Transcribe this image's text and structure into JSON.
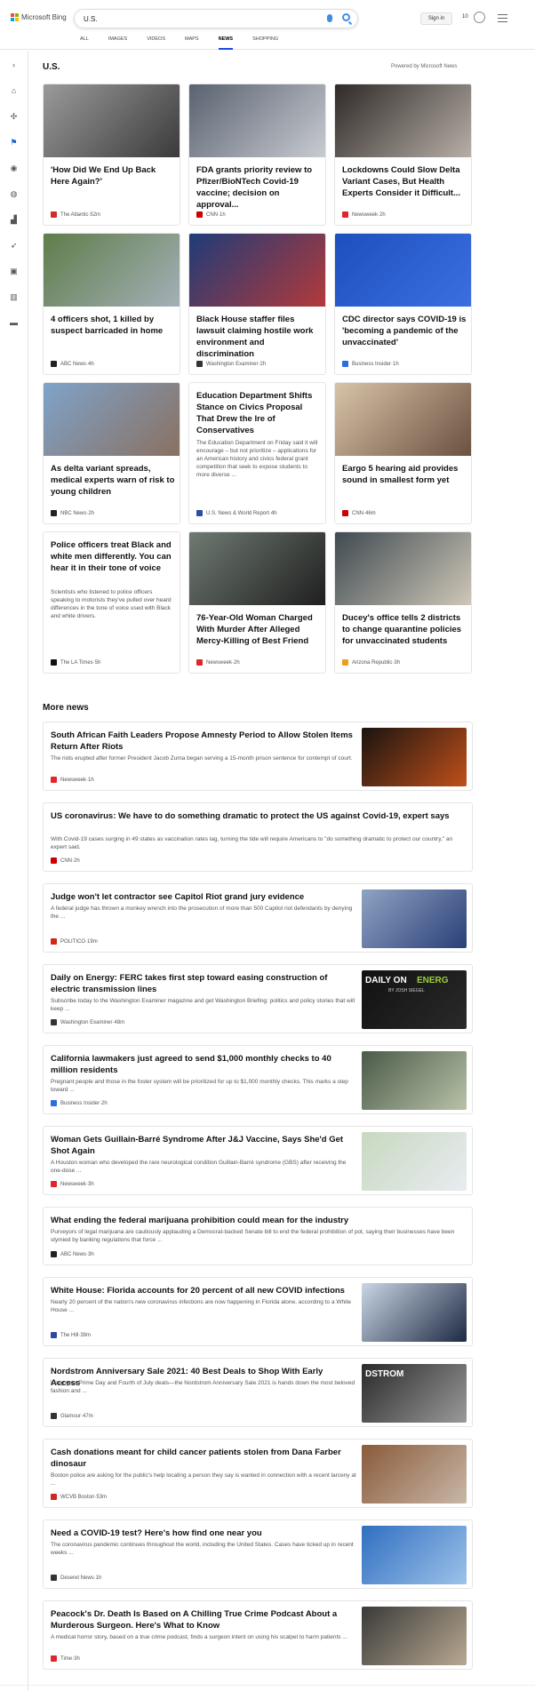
{
  "header": {
    "logo_text": "Microsoft Bing",
    "search_query": "U.S.",
    "sign_in": "Sign in",
    "rewards_count": "10"
  },
  "tabs": [
    {
      "label": "ALL",
      "active": false
    },
    {
      "label": "IMAGES",
      "active": false
    },
    {
      "label": "VIDEOS",
      "active": false
    },
    {
      "label": "MAPS",
      "active": false
    },
    {
      "label": "NEWS",
      "active": true
    },
    {
      "label": "SHOPPING",
      "active": false
    }
  ],
  "sidebar": {
    "icons": [
      "expand-icon",
      "home-icon",
      "puzzle-icon",
      "flag-icon",
      "location-icon",
      "globe-icon",
      "chart-icon",
      "rocket-icon",
      "film-icon",
      "bank-icon",
      "card-icon"
    ]
  },
  "section": {
    "title": "U.S.",
    "powered_by": "Powered by Microsoft News"
  },
  "cards": [
    {
      "title": "'How Did We End Up Back Here Again?'",
      "source": "The Atlantic",
      "time": "52m",
      "fav_color": "#d62828",
      "img_colors": [
        "#9a9a9a",
        "#3a3a3a"
      ]
    },
    {
      "title": "FDA grants priority review to Pfizer/BioNTech Covid-19 vaccine; decision on approval...",
      "source": "CNN",
      "time": "1h",
      "fav_color": "#cc0000",
      "img_colors": [
        "#5a6270",
        "#c9ccd2"
      ]
    },
    {
      "title": "Lockdowns Could Slow Delta Variant Cases, But Health Experts Consider it Difficult...",
      "source": "Newsweek",
      "time": "2h",
      "fav_color": "#e0262d",
      "img_colors": [
        "#2f2a28",
        "#b8b0a8"
      ]
    },
    {
      "title": "4 officers shot, 1 killed by suspect barricaded in home",
      "source": "ABC News",
      "time": "4h",
      "fav_color": "#222222",
      "img_colors": [
        "#5f7d4a",
        "#a4b0b8"
      ]
    },
    {
      "title": "Black House staffer files lawsuit claiming hostile work environment and discrimination",
      "source": "Washington Examiner",
      "time": "2h",
      "fav_color": "#333333",
      "img_colors": [
        "#1f3b78",
        "#b33a3a"
      ]
    },
    {
      "title": "CDC director says COVID-19 is 'becoming a pandemic of the unvaccinated'",
      "source": "Business Insider",
      "time": "1h",
      "fav_color": "#2a6de0",
      "img_colors": [
        "#1e4fbf",
        "#3b6fe0"
      ]
    },
    {
      "title": "As delta variant spreads, medical experts warn of risk to young children",
      "source": "NBC News",
      "time": "2h",
      "fav_color": "#222222",
      "img_colors": [
        "#7fa3c9",
        "#8a7060"
      ]
    },
    {
      "title": "Education Department Shifts Stance on Civics Proposal That Drew the Ire of Conservatives",
      "snippet": "The Education Department on Friday said it will encourage – but not prioritize – applications for an American history and civics federal grant competition that seek to expose students to more diverse ...",
      "source": "U.S. News & World Report",
      "time": "4h",
      "fav_color": "#2b4f9e",
      "text_only": true
    },
    {
      "title": "Eargo 5 hearing aid provides sound in smallest form yet",
      "source": "CNN",
      "time": "46m",
      "fav_color": "#cc0000",
      "img_colors": [
        "#d8c4a8",
        "#6a5040"
      ]
    },
    {
      "title": "Police officers treat Black and white men differently. You can hear it in their tone of voice",
      "snippet": "Scientists who listened to police officers speaking to motorists they've pulled over heard differences in the tone of voice used with Black and white drivers.",
      "source": "The LA Times",
      "time": "5h",
      "fav_color": "#111111",
      "text_only": true
    },
    {
      "title": "76-Year-Old Woman Charged With Murder After Alleged Mercy-Killing of Best Friend",
      "source": "Newsweek",
      "time": "2h",
      "fav_color": "#e0262d",
      "img_colors": [
        "#6f7a72",
        "#1e1e1e"
      ]
    },
    {
      "title": "Ducey's office tells 2 districts to change quarantine policies for unvaccinated students",
      "source": "Arizona Republic",
      "time": "3h",
      "fav_color": "#e8a020",
      "img_colors": [
        "#3f4a52",
        "#d0c8b8"
      ]
    }
  ],
  "more_news": {
    "title": "More news",
    "items": [
      {
        "title": "South African Faith Leaders Propose Amnesty Period to Allow Stolen Items Return After Riots",
        "snippet": "The riots erupted after former President Jacob Zuma began serving a 15-month prison sentence for contempt of court.",
        "source": "Newsweek",
        "time": "1h",
        "fav_color": "#e0262d",
        "thumb": [
          "#1a1410",
          "#c0501a"
        ]
      },
      {
        "title": "US coronavirus: We have to do something dramatic to protect the US against Covid-19, expert says",
        "snippet": "With Covid-19 cases surging in 49 states as vaccination rates lag, turning the tide will require Americans to \"do something dramatic to protect our country,\" an expert said.",
        "source": "CNN",
        "time": "2h",
        "fav_color": "#cc0000"
      },
      {
        "title": "Judge won't let contractor see Capitol Riot grand jury evidence",
        "snippet": "A federal judge has thrown a monkey wrench into the prosecution of more than 500 Capitol riot defendants by denying the ...",
        "source": "POLITICO",
        "time": "19m",
        "fav_color": "#d0271d",
        "thumb": [
          "#8fa3c2",
          "#2a3f78"
        ]
      },
      {
        "title": "Daily on Energy: FERC takes first step toward easing construction of electric transmission lines",
        "snippet": "Subscribe today to the Washington Examiner magazine and get Washington Briefing: politics and policy stories that will keep ...",
        "source": "Washington Examiner",
        "time": "48m",
        "fav_color": "#333333",
        "thumb": [
          "#111111",
          "#2a2a2a"
        ],
        "thumb_text": "DAILY ON",
        "thumb_accent": "ENERG",
        "thumb_sub": "BY JOSH SIEGEL"
      },
      {
        "title": "California lawmakers just agreed to send $1,000 monthly checks to 40 million residents",
        "snippet": "Pregnant people and those in the foster system will be prioritized for up to $1,000 monthly checks. This marks a step toward ...",
        "source": "Business Insider",
        "time": "2h",
        "fav_color": "#2a6de0",
        "thumb": [
          "#4a5a48",
          "#b8c2a8"
        ]
      },
      {
        "title": "Woman Gets Guillain-Barré Syndrome After J&J Vaccine, Says She'd Get Shot Again",
        "snippet": "A Houston woman who developed the rare neurological condition Guillain-Barré syndrome (GBS) after receiving the one-dose ...",
        "source": "Newsweek",
        "time": "3h",
        "fav_color": "#e0262d",
        "thumb": [
          "#c8d8c0",
          "#e8ecf0"
        ]
      },
      {
        "title": "What ending the federal marijuana prohibition could mean for the industry",
        "snippet": "Purveyors of legal marijuana are cautiously applauding a Democrat-backed Senate bill to end the federal prohibition of pot, saying their businesses have been stymied by banking regulations that force ...",
        "source": "ABC News",
        "time": "3h",
        "fav_color": "#222222"
      },
      {
        "title": "White House: Florida accounts for 20 percent of all new COVID infections",
        "snippet": "Nearly 20 percent of the nation's new coronavirus infections are now happening in Florida alone, according to a White House ...",
        "source": "The Hill",
        "time": "39m",
        "fav_color": "#2b4a9e",
        "thumb": [
          "#c9d6e4",
          "#1d2a44"
        ]
      },
      {
        "title": "Nordstrom Anniversary Sale 2021: 40 Best Deals to Shop With Early Access",
        "snippet": "Keep your Prime Day and Fourth of July deals—the Nordstrom Anniversary Sale 2021 is hands down the most beloved fashion and ...",
        "source": "Glamour",
        "time": "47m",
        "fav_color": "#333333",
        "thumb": [
          "#2a2a2a",
          "#9a9a9a"
        ],
        "thumb_text": "DSTROM"
      },
      {
        "title": "Cash donations meant for child cancer patients stolen from Dana Farber dinosaur",
        "snippet": "Boston police are asking for the public's help locating a person they say is wanted in connection with a recent larceny at ...",
        "source": "WCVB Boston",
        "time": "53m",
        "fav_color": "#d0271d",
        "thumb": [
          "#8a5a3a",
          "#c8b8a8"
        ]
      },
      {
        "title": "Need a COVID-19 test? Here's how find one near you",
        "snippet": "The coronavirus pandemic continues throughout the world, including the United States. Cases have ticked up in recent weeks ...",
        "source": "Deseret News",
        "time": "1h",
        "fav_color": "#333333",
        "thumb": [
          "#2f6fc0",
          "#9ec2ea"
        ]
      },
      {
        "title": "Peacock's Dr. Death Is Based on A Chilling True Crime Podcast About a Murderous Surgeon. Here's What to Know",
        "snippet": "A medical horror story, based on a true crime podcast, finds a surgeon intent on using his scalpel to harm patients ...",
        "source": "Time",
        "time": "3h",
        "fav_color": "#e0262d",
        "thumb": [
          "#3a3a3a",
          "#b8a890"
        ]
      }
    ]
  }
}
